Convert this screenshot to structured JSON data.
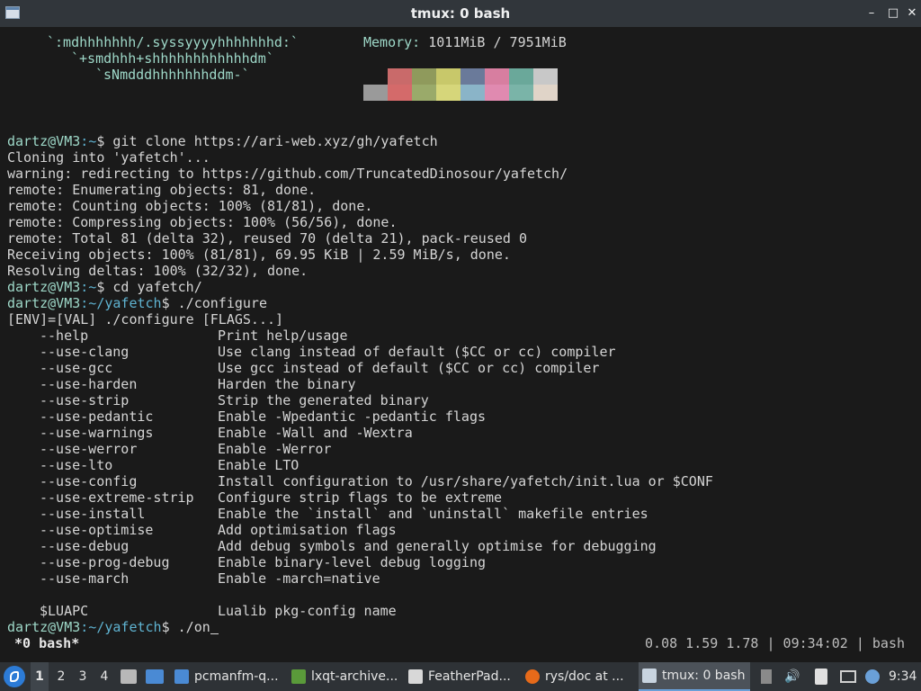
{
  "window": {
    "title": "tmux: 0 bash",
    "minimize": "–",
    "maximize": "□",
    "close": "✕"
  },
  "terminal": {
    "art": [
      "`:mdhhhhhhh/.syssyyyyhhhhhhhd:`",
      "`+smdhhh+shhhhhhhhhhhhdm`",
      "`sNmdddhhhhhhhddm-`"
    ],
    "memory_label": "Memory:",
    "memory_value": " 1011MiB / 7951MiB",
    "palette_top": [
      "#1a1a1a",
      "#c96a6a",
      "#8f9a5c",
      "#c8c86a",
      "#6a7a9a",
      "#d77ea0",
      "#6aa89a",
      "#c8c8c8"
    ],
    "palette_bottom": [
      "#9a9a9a",
      "#d46a6a",
      "#9aaa6a",
      "#d6d67a",
      "#8ab4c8",
      "#e08ab0",
      "#7ab4a8",
      "#e0d4c8"
    ],
    "prompt1": {
      "user": "dartz@VM3",
      "path": ":~",
      "symbol": "$ ",
      "cmd": "git clone https://ari-web.xyz/gh/yafetch"
    },
    "output1": [
      "Cloning into 'yafetch'...",
      "warning: redirecting to https://github.com/TruncatedDinosour/yafetch/",
      "remote: Enumerating objects: 81, done.",
      "remote: Counting objects: 100% (81/81), done.",
      "remote: Compressing objects: 100% (56/56), done.",
      "remote: Total 81 (delta 32), reused 70 (delta 21), pack-reused 0",
      "Receiving objects: 100% (81/81), 69.95 KiB | 2.59 MiB/s, done.",
      "Resolving deltas: 100% (32/32), done."
    ],
    "prompt2": {
      "user": "dartz@VM3",
      "path": ":~",
      "symbol": "$ ",
      "cmd": "cd yafetch/"
    },
    "prompt3": {
      "user": "dartz@VM3",
      "path": ":~/yafetch",
      "symbol": "$ ",
      "cmd": "./configure"
    },
    "usage": "[ENV]=[VAL] ./configure [FLAGS...]",
    "flags": [
      {
        "flag": "--help",
        "desc": "Print help/usage"
      },
      {
        "flag": "--use-clang",
        "desc": "Use clang instead of default ($CC or cc) compiler"
      },
      {
        "flag": "--use-gcc",
        "desc": "Use gcc instead of default ($CC or cc) compiler"
      },
      {
        "flag": "--use-harden",
        "desc": "Harden the binary"
      },
      {
        "flag": "--use-strip",
        "desc": "Strip the generated binary"
      },
      {
        "flag": "--use-pedantic",
        "desc": "Enable -Wpedantic -pedantic flags"
      },
      {
        "flag": "--use-warnings",
        "desc": "Enable -Wall and -Wextra"
      },
      {
        "flag": "--use-werror",
        "desc": "Enable -Werror"
      },
      {
        "flag": "--use-lto",
        "desc": "Enable LTO"
      },
      {
        "flag": "--use-config",
        "desc": "Install configuration to /usr/share/yafetch/init.lua or $CONF"
      },
      {
        "flag": "--use-extreme-strip",
        "desc": "Configure strip flags to be extreme"
      },
      {
        "flag": "--use-install",
        "desc": "Enable the `install` and `uninstall` makefile entries"
      },
      {
        "flag": "--use-optimise",
        "desc": "Add optimisation flags"
      },
      {
        "flag": "--use-debug",
        "desc": "Add debug symbols and generally optimise for debugging"
      },
      {
        "flag": "--use-prog-debug",
        "desc": "Enable binary-level debug logging"
      },
      {
        "flag": "--use-march",
        "desc": "Enable -march=native"
      }
    ],
    "env_var": {
      "flag": "$LUAPC",
      "desc": "Lualib pkg-config name"
    },
    "prompt4": {
      "user": "dartz@VM3",
      "path": ":~/yafetch",
      "symbol": "$ ",
      "cmd": "./on"
    }
  },
  "tmux": {
    "window": "*0 bash*",
    "status_right": "0.08 1.59 1.78 | 09:34:02 | bash"
  },
  "taskbar": {
    "workspaces": [
      "1",
      "2",
      "3",
      "4"
    ],
    "active_workspace": "1",
    "tasks": [
      {
        "label": "pcmanfm-q...",
        "icon": "folder-icon",
        "color": "#4a8ad4"
      },
      {
        "label": "lxqt-archive...",
        "icon": "archive-icon",
        "color": "#5a9a3a"
      },
      {
        "label": "FeatherPad...",
        "icon": "featherpad-icon",
        "color": "#d8d8d8"
      },
      {
        "label": "rys/doc at ...",
        "icon": "firefox-icon",
        "color": "#e66a1a"
      },
      {
        "label": "tmux: 0 bash",
        "icon": "terminal-icon",
        "color": "#c8d4e0"
      }
    ],
    "clock": "9:34"
  }
}
